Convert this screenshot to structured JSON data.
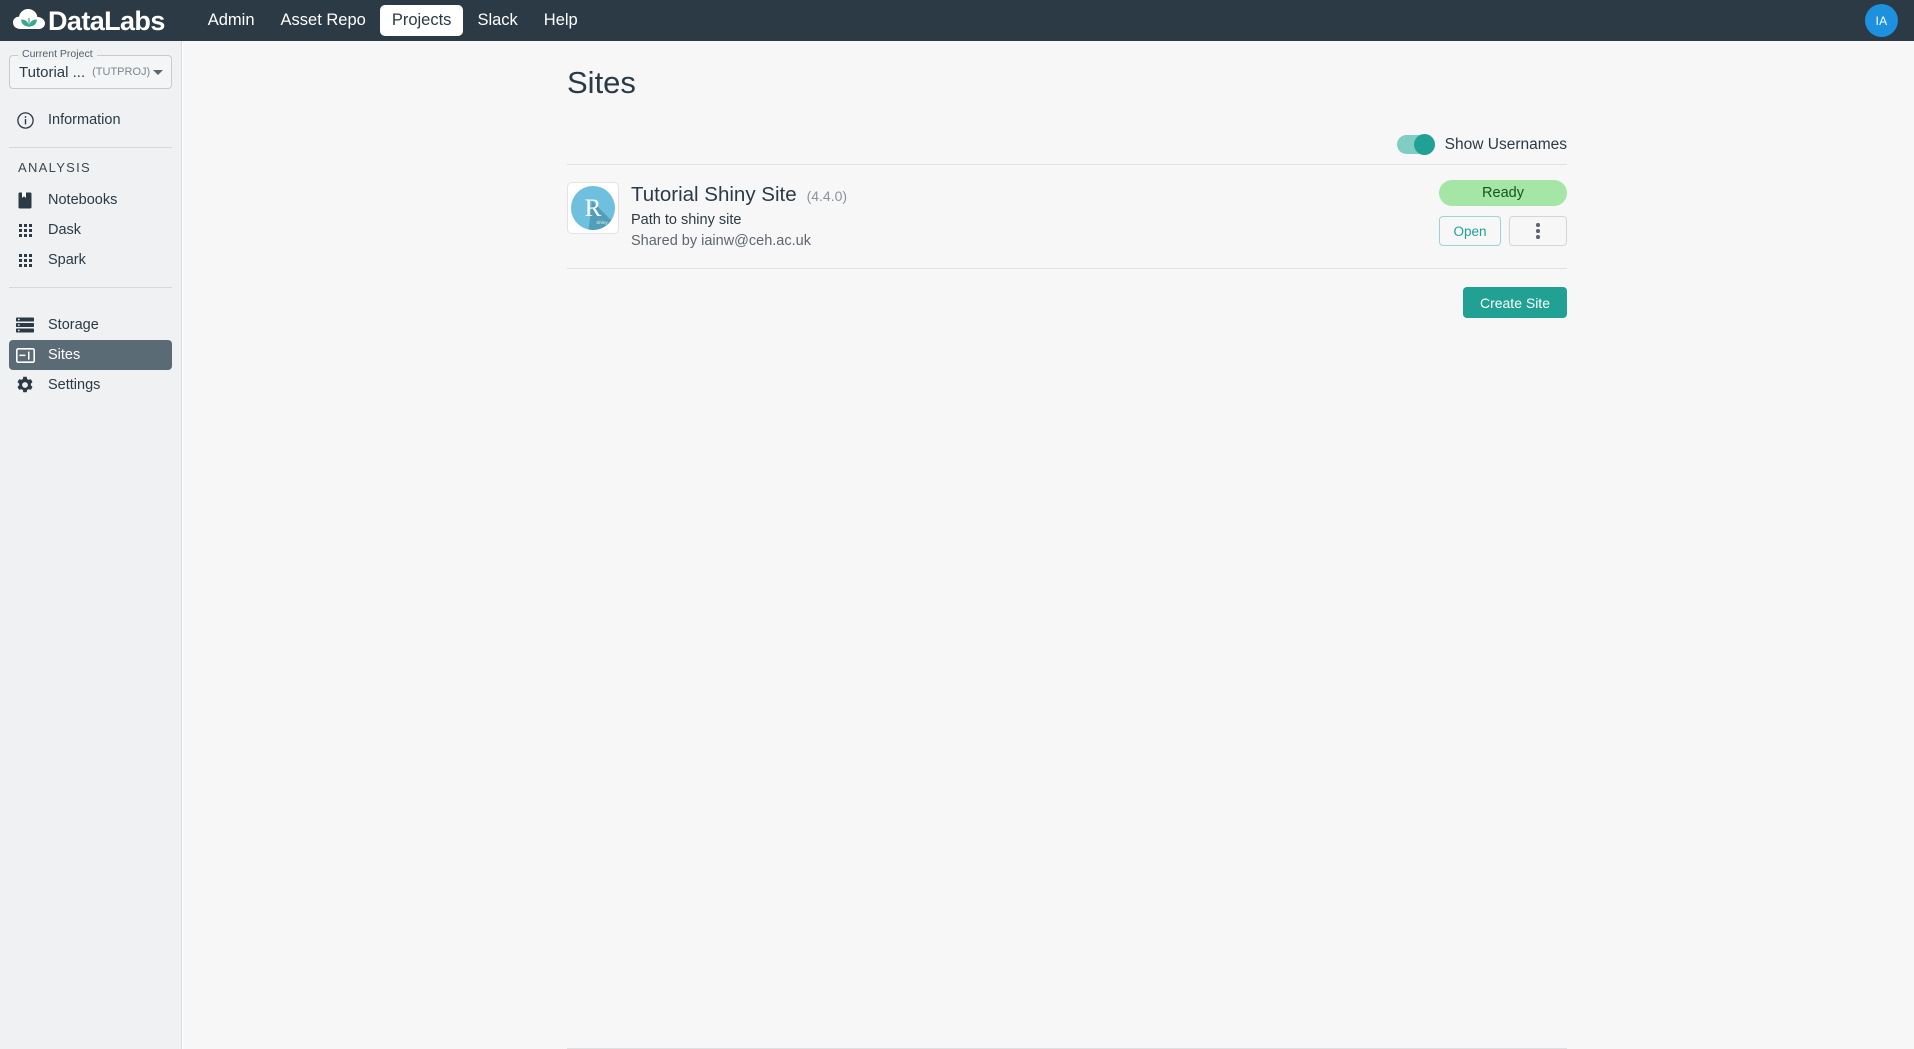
{
  "navbar": {
    "brand": "DataLabs",
    "brand_icon": "cloud-leaf-logo",
    "links": [
      {
        "label": "Admin",
        "active": false
      },
      {
        "label": "Asset Repo",
        "active": false
      },
      {
        "label": "Projects",
        "active": true
      },
      {
        "label": "Slack",
        "active": false
      },
      {
        "label": "Help",
        "active": false
      }
    ],
    "avatar_initials": "IA"
  },
  "sidebar": {
    "project_selector": {
      "legend": "Current Project",
      "name": "Tutorial ...",
      "code": "(TUTPROJ)",
      "caret_icon": "chevron-down-icon"
    },
    "information": {
      "label": "Information",
      "icon": "info-circle-icon"
    },
    "section_label": "ANALYSIS",
    "analysis_items": [
      {
        "label": "Notebooks",
        "icon": "notebook-icon",
        "active": false
      },
      {
        "label": "Dask",
        "icon": "grid-dots-icon",
        "active": false
      },
      {
        "label": "Spark",
        "icon": "grid-dots-icon",
        "active": false
      }
    ],
    "resource_items": [
      {
        "label": "Storage",
        "icon": "server-stack-icon",
        "active": false
      },
      {
        "label": "Sites",
        "icon": "window-layout-icon",
        "active": true
      },
      {
        "label": "Settings",
        "icon": "gear-icon",
        "active": false
      }
    ]
  },
  "main": {
    "page_title": "Sites",
    "show_usernames": {
      "label": "Show Usernames",
      "checked": true
    },
    "sites": [
      {
        "icon": "r-shiny-icon",
        "icon_letter": "R",
        "icon_caption": "Shiny",
        "title": "Tutorial Shiny Site",
        "version": "(4.4.0)",
        "path": "Path to shiny site",
        "shared_by": "Shared by iainw@ceh.ac.uk",
        "status": "Ready",
        "open_label": "Open",
        "menu_icon": "kebab-menu-icon"
      }
    ],
    "create_button": "Create Site"
  },
  "colors": {
    "navbar_bg": "#2b3a45",
    "sidebar_bg": "#f0f1f2",
    "main_bg": "#f7f7f8",
    "accent_teal": "#21a193",
    "status_ready_bg": "#a5e5a5",
    "status_ready_text": "#11581a",
    "avatar_bg": "#1d91dd",
    "shiny_blue": "#6ec0de"
  }
}
